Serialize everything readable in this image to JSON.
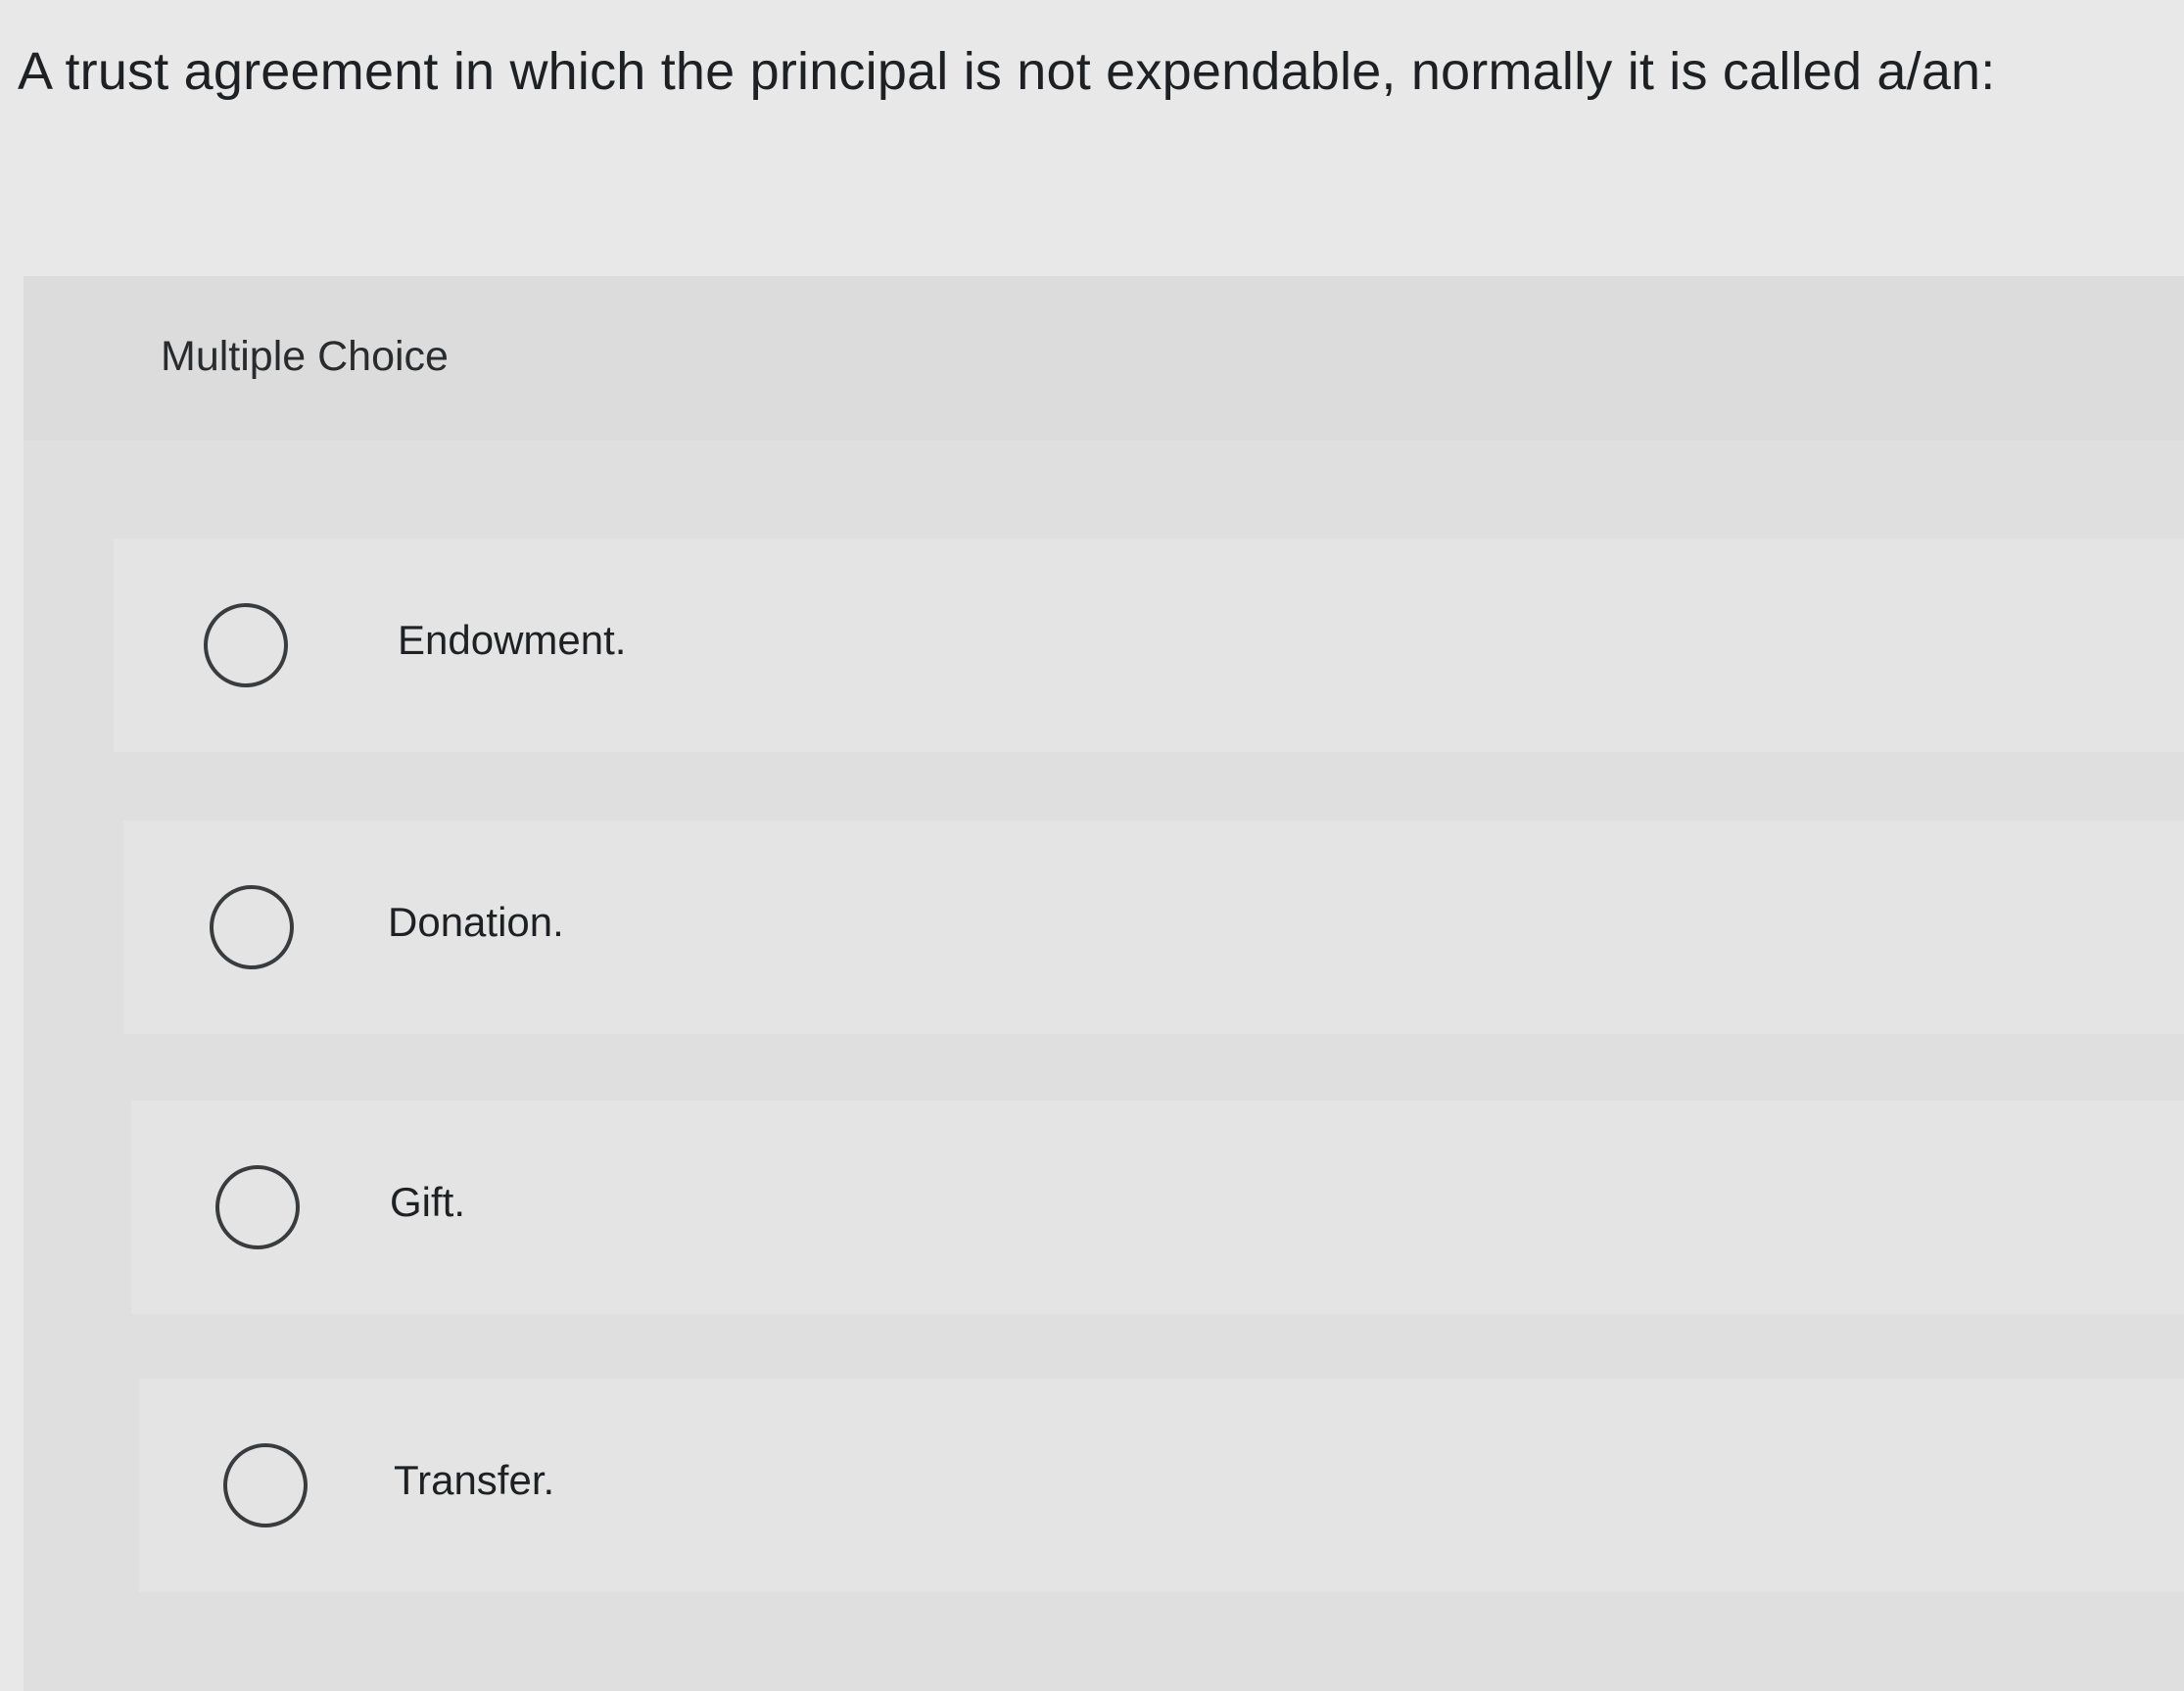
{
  "question": {
    "text": "A trust agreement in which the principal is not expendable, normally it is called a/an:"
  },
  "panel": {
    "title": "Multiple Choice"
  },
  "options": [
    {
      "label": "Endowment.",
      "selected": false
    },
    {
      "label": "Donation.",
      "selected": false
    },
    {
      "label": "Gift.",
      "selected": false
    },
    {
      "label": "Transfer.",
      "selected": false
    }
  ]
}
